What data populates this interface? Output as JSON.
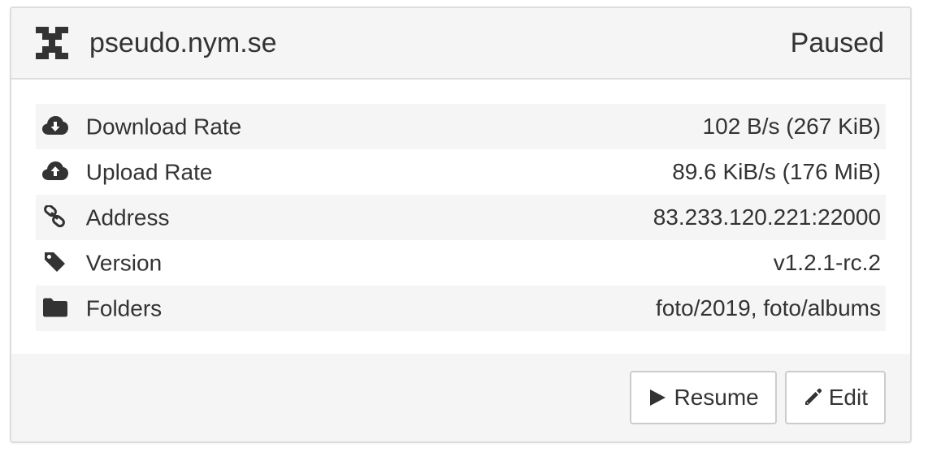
{
  "device": {
    "name": "pseudo.nym.se",
    "status": "Paused",
    "icon": "identicon-icon"
  },
  "rows": [
    {
      "icon": "cloud-download-icon",
      "label": "Download Rate",
      "value": "102 B/s (267 KiB)"
    },
    {
      "icon": "cloud-upload-icon",
      "label": "Upload Rate",
      "value": "89.6 KiB/s (176 MiB)"
    },
    {
      "icon": "link-icon",
      "label": "Address",
      "value": "83.233.120.221:22000"
    },
    {
      "icon": "tag-icon",
      "label": "Version",
      "value": "v1.2.1-rc.2"
    },
    {
      "icon": "folder-icon",
      "label": "Folders",
      "value": "foto/2019, foto/albums"
    }
  ],
  "buttons": {
    "resume": {
      "label": "Resume",
      "icon": "play-icon"
    },
    "edit": {
      "label": "Edit",
      "icon": "pencil-icon"
    }
  },
  "colors": {
    "heading_bg": "#f5f5f5",
    "border": "#dddddd",
    "stripe": "#f5f5f5",
    "text": "#333333"
  }
}
